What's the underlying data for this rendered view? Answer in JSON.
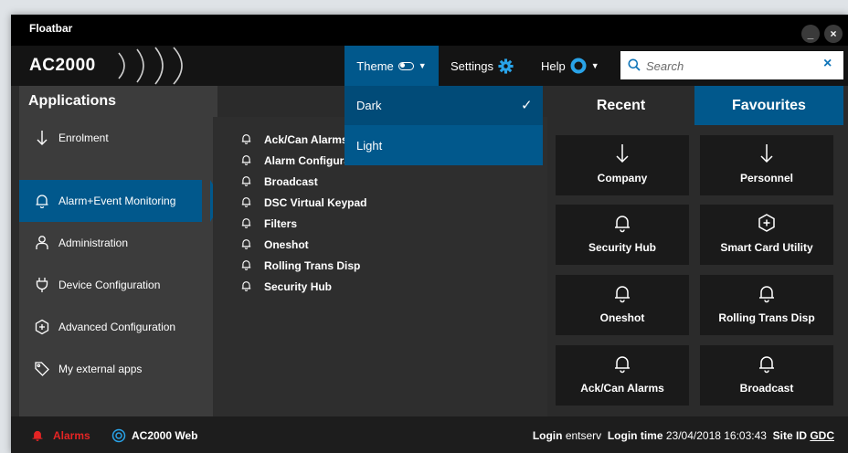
{
  "window": {
    "title": "Floatbar",
    "minimize_label": "_",
    "close_label": "×"
  },
  "header": {
    "brand": "AC2000",
    "theme_label": "Theme",
    "settings_label": "Settings",
    "help_label": "Help",
    "search": {
      "placeholder": "Search",
      "value": "",
      "clear_label": "×"
    }
  },
  "theme_dropdown": {
    "options": [
      {
        "label": "Dark",
        "selected": true,
        "check": "✓"
      },
      {
        "label": "Light",
        "selected": false
      }
    ]
  },
  "sidebar": {
    "title": "Applications",
    "items": [
      {
        "label": "Enrolment",
        "icon": "arrow-down-icon"
      },
      {
        "label": "Alarm+Event Monitoring",
        "icon": "bell-icon",
        "active": true
      },
      {
        "label": "Administration",
        "icon": "person-icon"
      },
      {
        "label": "Device Configuration",
        "icon": "plug-icon"
      },
      {
        "label": "Advanced Configuration",
        "icon": "advanced-config-icon"
      },
      {
        "label": "My external apps",
        "icon": "tag-icon"
      }
    ]
  },
  "apps": [
    {
      "label": "Ack/Can Alarms"
    },
    {
      "label": "Alarm Configuration"
    },
    {
      "label": "Broadcast"
    },
    {
      "label": "DSC Virtual Keypad"
    },
    {
      "label": "Filters"
    },
    {
      "label": "Oneshot"
    },
    {
      "label": "Rolling Trans Disp"
    },
    {
      "label": "Security Hub"
    }
  ],
  "right_panel": {
    "tabs": [
      {
        "label": "Recent"
      },
      {
        "label": "Favourites",
        "active": true
      }
    ],
    "tiles": [
      {
        "label": "Company",
        "icon": "arrow-down-icon"
      },
      {
        "label": "Personnel",
        "icon": "arrow-down-icon"
      },
      {
        "label": "Security Hub",
        "icon": "bell-icon"
      },
      {
        "label": "Smart Card Utility",
        "icon": "advanced-config-icon"
      },
      {
        "label": "Oneshot",
        "icon": "bell-icon"
      },
      {
        "label": "Rolling Trans Disp",
        "icon": "bell-icon"
      },
      {
        "label": "Ack/Can Alarms",
        "icon": "bell-icon"
      },
      {
        "label": "Broadcast",
        "icon": "bell-icon"
      }
    ]
  },
  "status_bar": {
    "alarms_label": "Alarms",
    "web_label": "AC2000 Web",
    "login_label": "Login",
    "login_value": "entserv",
    "login_time_label": "Login time",
    "login_time_value": "23/04/2018 16:03:43",
    "site_id_label": "Site ID",
    "site_id_value": "GDC"
  },
  "colors": {
    "accent": "#01588c",
    "alarm": "#e52424",
    "background": "#2b2b2b",
    "title_bar": "#000000"
  }
}
